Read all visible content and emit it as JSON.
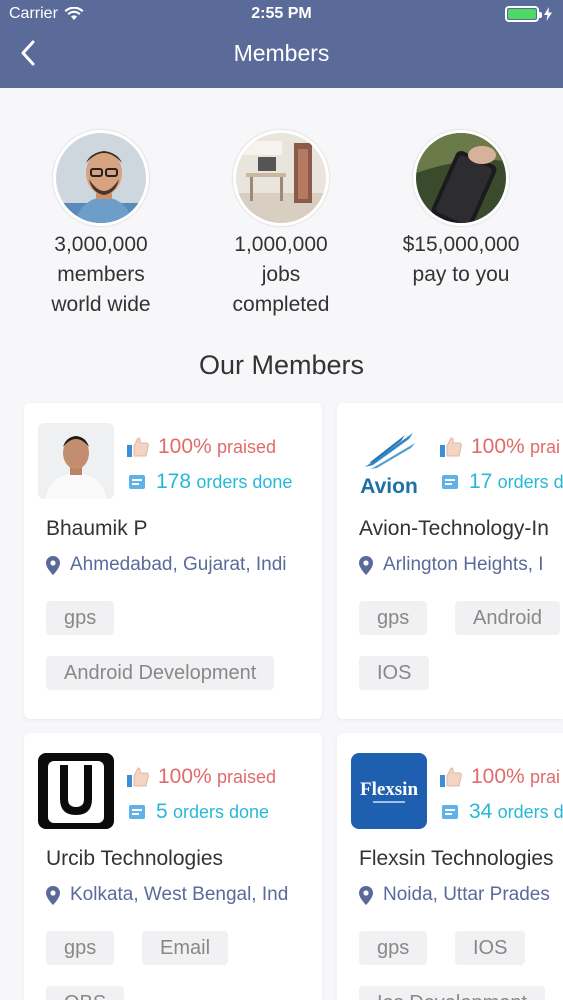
{
  "status_bar": {
    "carrier": "Carrier",
    "time": "2:55 PM"
  },
  "header": {
    "title": "Members"
  },
  "stats": [
    {
      "line1": "3,000,000",
      "line2": "members",
      "line3": "world wide",
      "icon": "person-photo"
    },
    {
      "line1": "1,000,000",
      "line2": "jobs",
      "line3": "completed",
      "icon": "workspace-photo"
    },
    {
      "line1": "$15,000,000",
      "line2": "pay to you",
      "line3": "",
      "icon": "phone-photo"
    }
  ],
  "section": {
    "title": "Our Members"
  },
  "members": [
    {
      "name": "Bhaumik P",
      "location": "Ahmedabad, Gujarat, Indi",
      "praised_value": "100%",
      "praised_label": "praised",
      "orders_value": "178",
      "orders_label": "orders done",
      "tags": [
        "gps",
        "Android Development"
      ]
    },
    {
      "name": "Avion-Technology-In",
      "location": "Arlington Heights, I",
      "logo_text": "Avion",
      "praised_value": "100%",
      "praised_label": "prai",
      "orders_value": "17",
      "orders_label": "orders d",
      "tags": [
        "gps",
        "Android",
        "IOS"
      ]
    },
    {
      "name": "Urcib Technologies",
      "location": "Kolkata, West Bengal, Ind",
      "logo_text": "U",
      "praised_value": "100%",
      "praised_label": "praised",
      "orders_value": "5",
      "orders_label": "orders done",
      "tags": [
        "gps",
        "Email",
        "QBS"
      ]
    },
    {
      "name": "Flexsin Technologies",
      "location": "Noida, Uttar Prades",
      "logo_text": "Flexsin",
      "praised_value": "100%",
      "praised_label": "prai",
      "orders_value": "34",
      "orders_label": "orders d",
      "tags": [
        "gps",
        "IOS",
        "Ios Development"
      ]
    }
  ],
  "colors": {
    "header": "#5a6b99",
    "praised": "#e06b6b",
    "orders": "#27b8d8",
    "battery": "#4cd964"
  }
}
